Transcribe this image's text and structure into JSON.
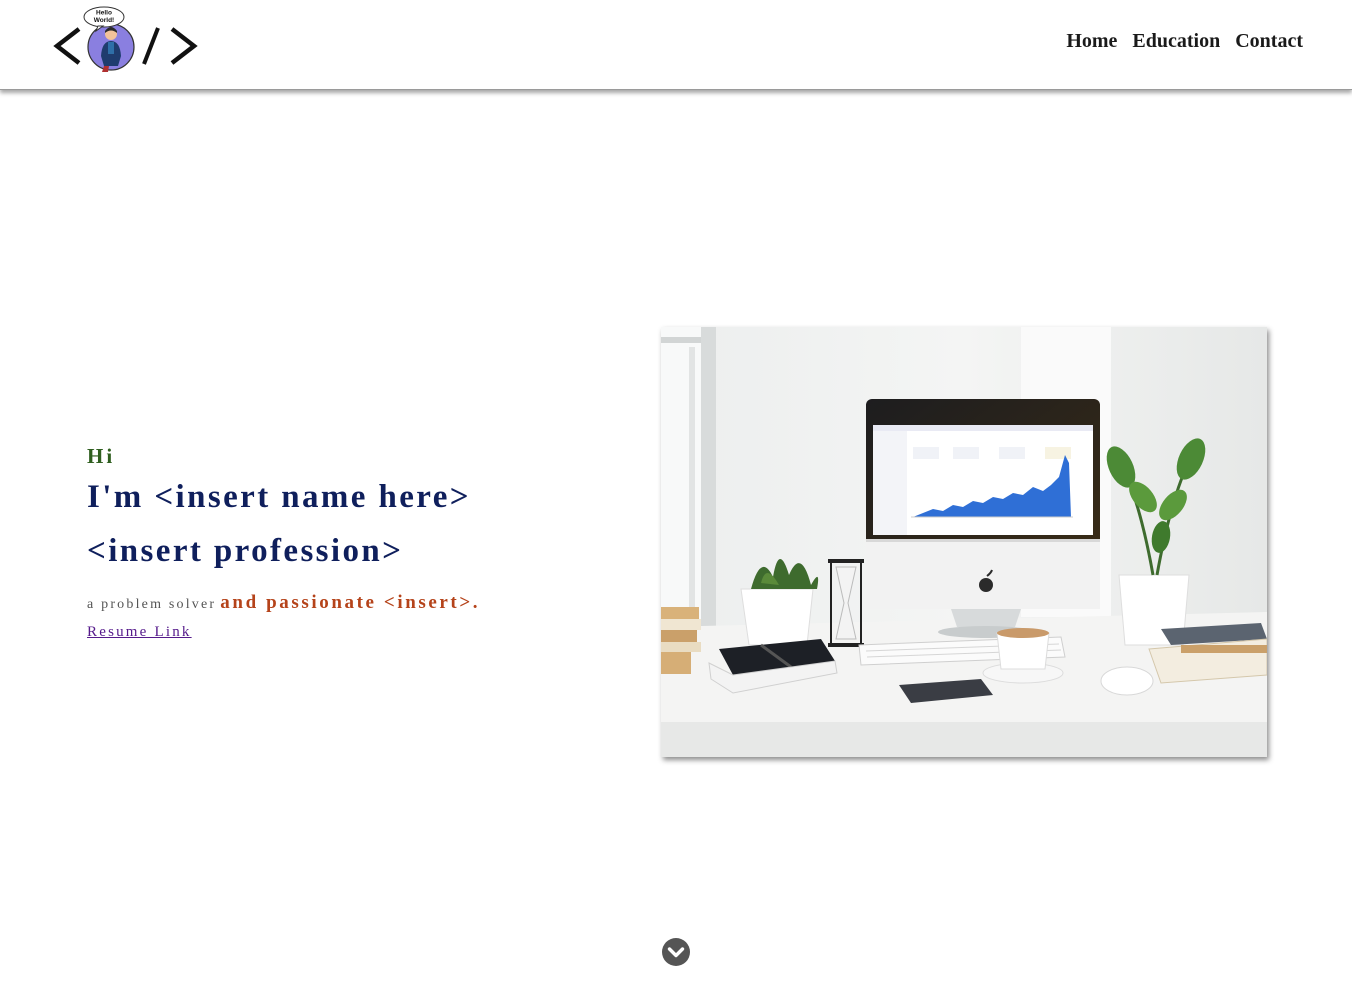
{
  "header": {
    "logo": {
      "speech_bubble_text": "Hello World!",
      "symbols": [
        "<",
        "/",
        ">"
      ],
      "icon": "avatar-code-logo"
    },
    "nav": [
      {
        "label": "Home"
      },
      {
        "label": "Education"
      },
      {
        "label": "Contact"
      }
    ]
  },
  "hero": {
    "greeting": "Hi",
    "name_line": "I'm <insert name here>",
    "profession_line": "<insert profession>",
    "tagline_plain": "a problem solver",
    "tagline_accent": "and passionate <insert>.",
    "resume_link": "Resume Link",
    "image": {
      "icon": "desk-workspace-photo"
    }
  },
  "scroll_button": {
    "icon": "chevron-down-circle-icon"
  },
  "colors": {
    "greeting": "#2e5e1e",
    "heading": "#0f1f5c",
    "accent": "#b5431a",
    "link": "#551a8b",
    "scroll_button": "#555555"
  }
}
